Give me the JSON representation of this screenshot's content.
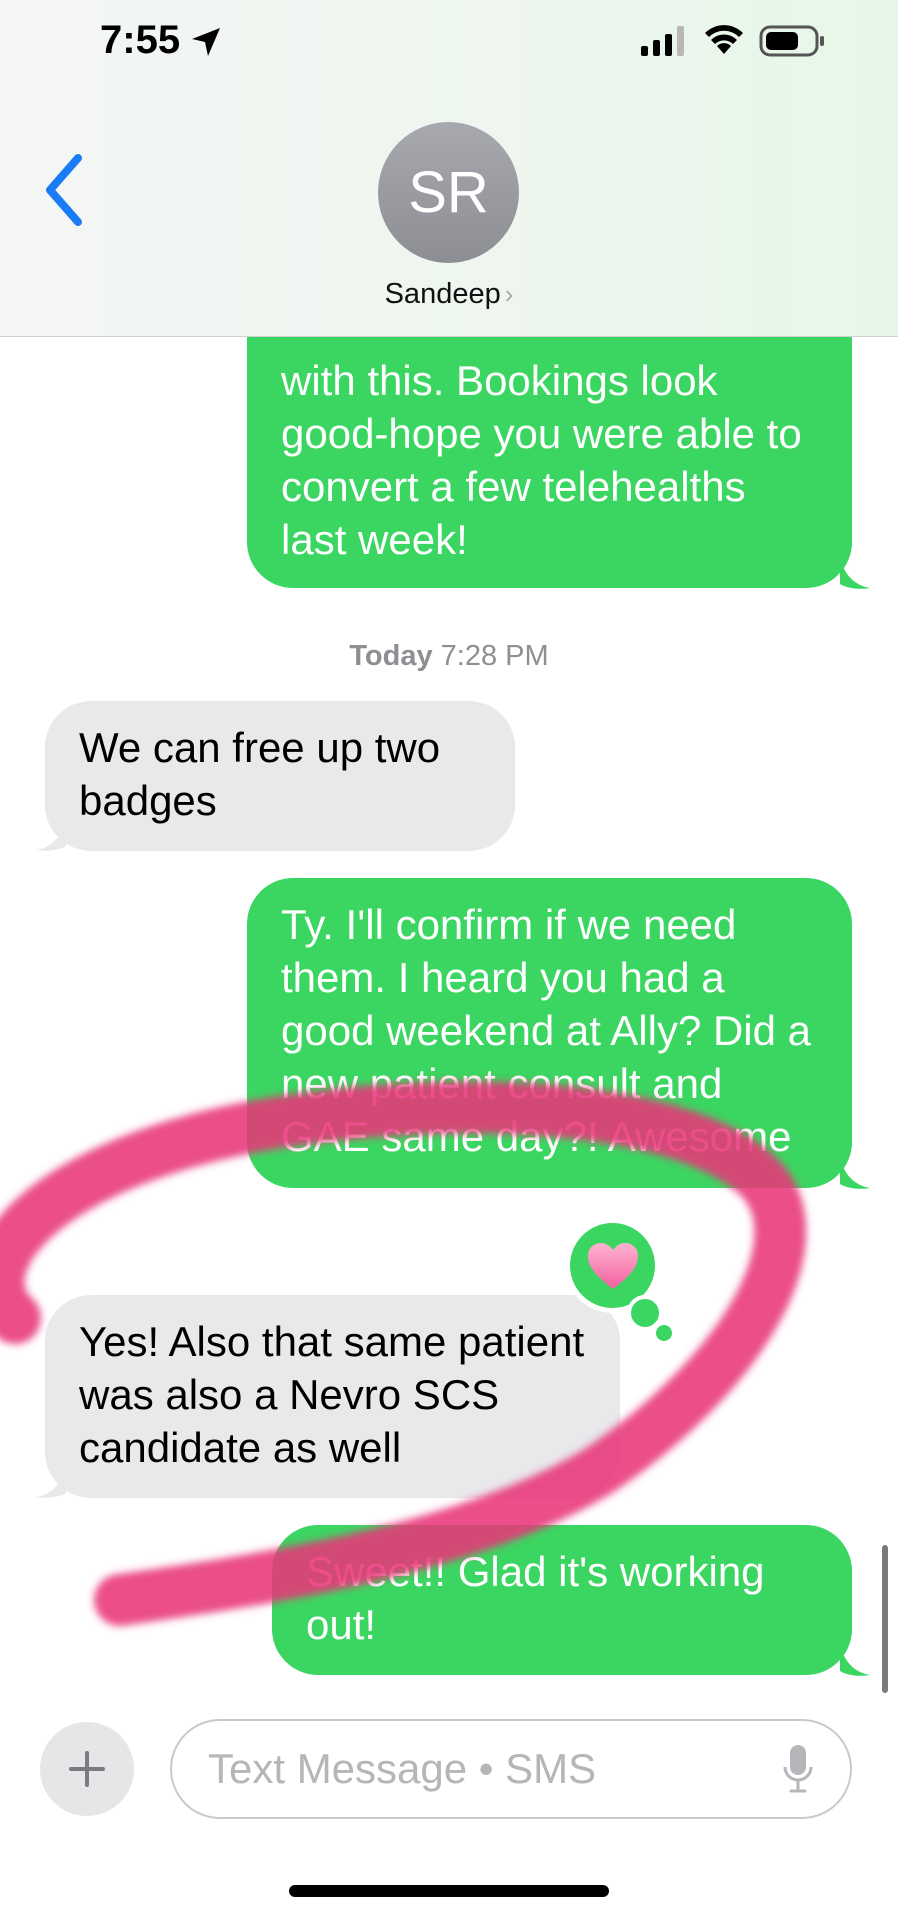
{
  "status_bar": {
    "time": "7:55"
  },
  "header": {
    "avatar_initials": "SR",
    "contact_name": "Sandeep",
    "chevron": "›"
  },
  "messages": [
    {
      "direction": "outgoing",
      "text": "with this. Bookings look good-hope you were able to convert a few telehealths last week!"
    },
    {
      "direction": "incoming",
      "text": "We can free up two badges"
    },
    {
      "direction": "outgoing",
      "text": "Ty. I'll confirm if we need them. I heard you had a good weekend at Ally? Did a new patient consult and GAE same day?! Awesome"
    },
    {
      "direction": "incoming",
      "text": "Yes! Also that same patient was also a Nevro SCS candidate as well",
      "tapback": "heart"
    },
    {
      "direction": "outgoing",
      "text": "Sweet!! Glad it's working out!"
    }
  ],
  "timestamp": {
    "day": "Today",
    "time": "7:28 PM"
  },
  "compose": {
    "placeholder": "Text Message • SMS"
  },
  "colors": {
    "outgoing_bubble": "#3bd661",
    "incoming_bubble": "#e9e9eb",
    "accent": "#1a7cf5",
    "scribble": "#e8377a"
  }
}
